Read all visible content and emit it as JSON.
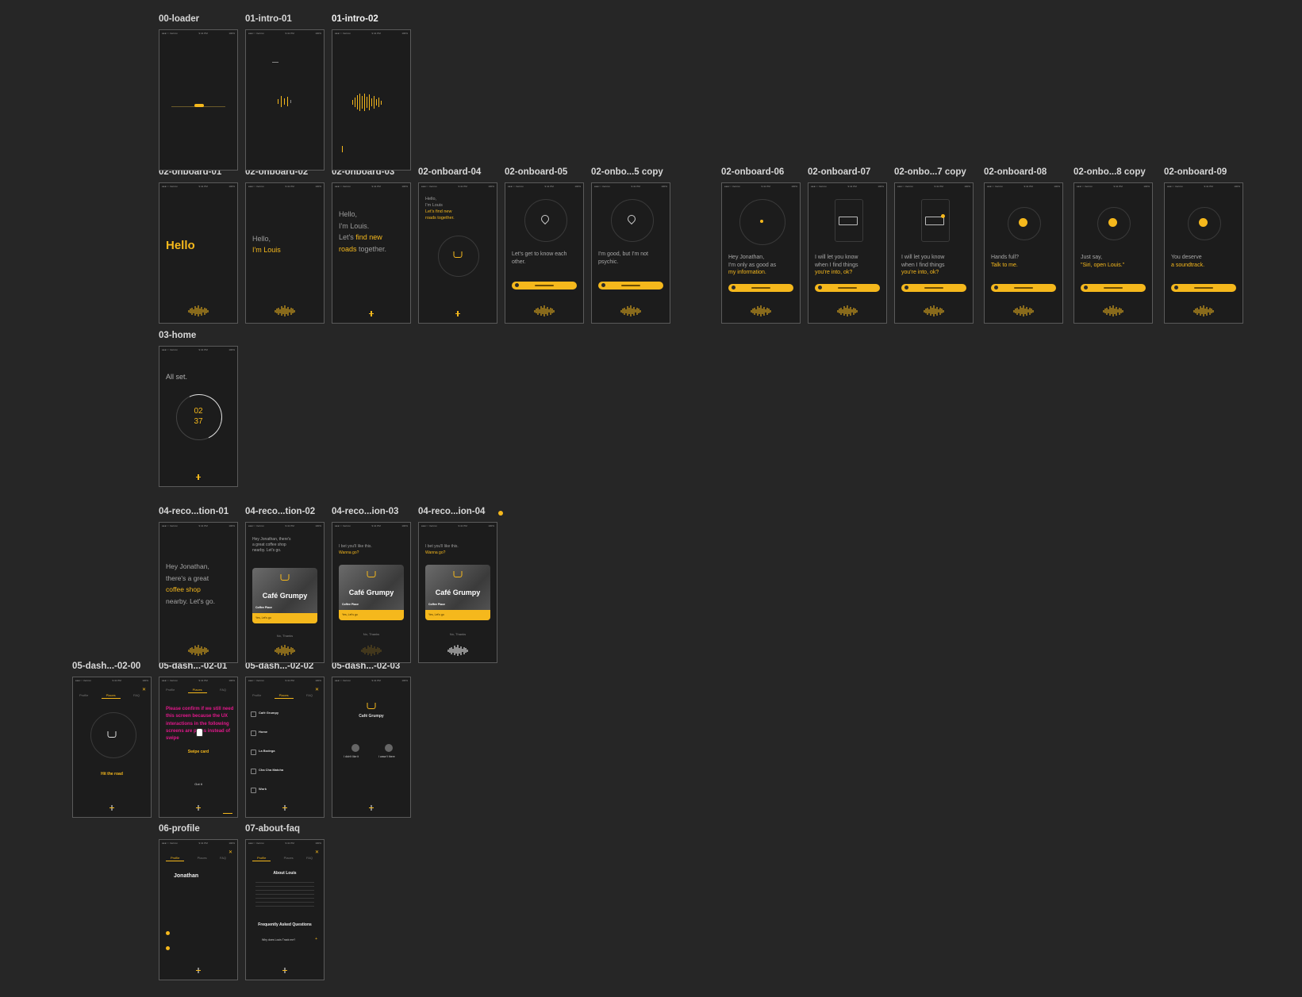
{
  "accent_color": "#f5b81c",
  "canvas_bg": "#262626",
  "artboards": {
    "loader": "00-loader",
    "intro01": "01-intro-01",
    "intro02": "01-intro-02",
    "onb01": "02-onboard-01",
    "onb02": "02-onboard-02",
    "onb03": "02-onboard-03",
    "onb04": "02-onboard-04",
    "onb05": "02-onboard-05",
    "onb05c": "02-onbo...5 copy",
    "onb06": "02-onboard-06",
    "onb07": "02-onboard-07",
    "onb07c": "02-onbo...7 copy",
    "onb08": "02-onboard-08",
    "onb08c": "02-onbo...8 copy",
    "onb09": "02-onboard-09",
    "home": "03-home",
    "reco01": "04-reco...tion-01",
    "reco02": "04-reco...tion-02",
    "reco03": "04-reco...ion-03",
    "reco04": "04-reco...ion-04",
    "dash00": "05-dash...-02-00",
    "dash01": "05-dash...-02-01",
    "dash02": "05-dash...-02-02",
    "dash03": "05-dash...-02-03",
    "profile": "06-profile",
    "faq": "07-about-faq"
  },
  "screens": {
    "onb01_hello": "Hello",
    "onb02_l1": "Hello,",
    "onb02_l2": "I'm Louis",
    "onb03_l1": "Hello,",
    "onb03_l2": "I'm Louis.",
    "onb03_l3a": "Let's",
    "onb03_l3b": "find new",
    "onb03_l4a": "roads",
    "onb03_l4b": "together.",
    "onb04_l1": "Hello,",
    "onb04_l2": "I'm Louis",
    "onb04_l3": "Let's find new",
    "onb04_l4": "roads together.",
    "onb05_txt": "Let's get to know each other.",
    "onb05c_txt": "I'm good, but I'm not psychic.",
    "onb06_l1": "Hey Jonathan,",
    "onb06_l2": "I'm only as good as",
    "onb06_l3": "my information.",
    "onb07_l1": "I will let you  know",
    "onb07_l2": "when I find things",
    "onb07_l3": "you're into, ok?",
    "onb08_l1": "Hands full?",
    "onb08_l2": "Talk to me.",
    "onb08c_l1": "Just say,",
    "onb08c_l2": "\"Siri, open Louis.\"",
    "onb09_l1": "You deserve",
    "onb09_l2": "a soundtrack.",
    "home_title": "All set.",
    "home_h": "02",
    "home_m": "37",
    "reco01_l1": "Hey Jonathan,",
    "reco01_l2": "there's a great",
    "reco01_l3": "coffee shop",
    "reco01_l4": "nearby. Let's go.",
    "reco02_head": "Hey Jonathan, there's a great coffee shop nearby. Let's go.",
    "reco03_l1": "I bet you'll like this.",
    "reco03_l2": "Wanna go?",
    "cafe_name": "Café Grumpy",
    "cafe_type": "Coffee Place",
    "cafe_go": "Yes, Let's go",
    "cafe_no": "No, Thanks",
    "dash_tab_profile": "Profile",
    "dash_tab_places": "Places",
    "dash_tab_faq": "FAQ",
    "dash00_title": "Hit the road",
    "dash01_note": "Please confirm if we still need this screen because the UX interactions in the following screens are press instead of swipe",
    "dash01_swipe": "Swipe card",
    "dash01_got": "Got it",
    "dash02_items": [
      "Café Grumpy",
      "Home",
      "La Bodega",
      "Cha Cha Matcha",
      "Work"
    ],
    "dash03_title": "Café Grumpy",
    "dash03_a": "I didn't like it",
    "dash03_b": "I wasn't there",
    "profile_name": "Jonathan",
    "faq_about": "About Louis",
    "faq_title": "Frequently Asked Questions",
    "faq_q1": "Why does Louis Track me?"
  }
}
